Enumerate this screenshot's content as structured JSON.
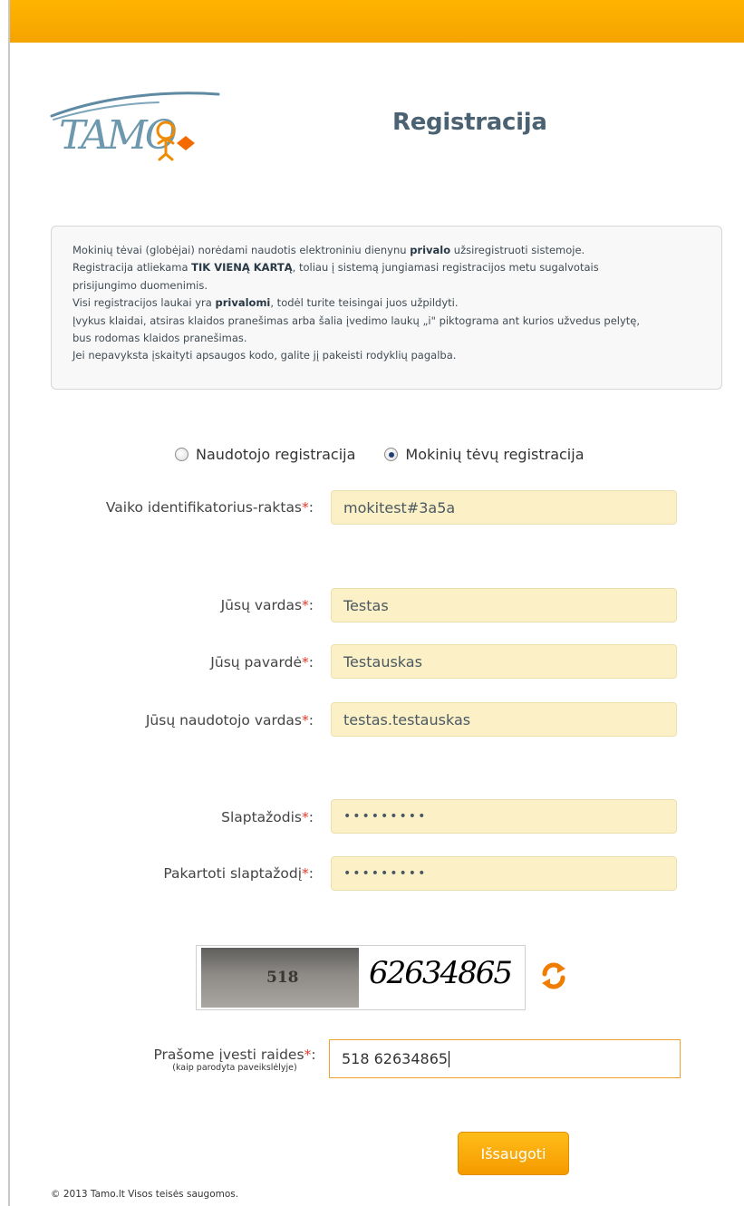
{
  "header": {
    "logo_text": "TAMO",
    "title": "Registracija"
  },
  "info": {
    "line1_a": "Mokinių tėvai (globėjai) norėdami naudotis elektroniniu dienynu ",
    "line1_b": "privalo",
    "line1_c": " užsiregistruoti sistemoje.",
    "line2_a": "Registracija atliekama ",
    "line2_b": "TIK VIENĄ KARTĄ",
    "line2_c": ", toliau į sistemą jungiamasi registracijos metu sugalvotais",
    "line3": "prisijungimo duomenimis.",
    "line4_a": "Visi registracijos laukai yra ",
    "line4_b": "privalomi",
    "line4_c": ", todėl turite teisingai juos užpildyti.",
    "line5": "Įvykus klaidai, atsiras klaidos pranešimas arba šalia įvedimo laukų „i\" piktograma ant kurios užvedus pelytę,",
    "line6": "bus rodomas klaidos pranešimas.",
    "line7": "Jei nepavyksta įskaityti apsaugos kodo, galite jį pakeisti rodyklių pagalba."
  },
  "registration_type": {
    "options": [
      {
        "label": "Naudotojo registracija",
        "selected": false
      },
      {
        "label": "Mokinių tėvų registracija",
        "selected": true
      }
    ]
  },
  "form": {
    "required_mark": "*",
    "colon": ":",
    "child_key": {
      "label": "Vaiko identifikatorius-raktas",
      "value": "mokitest#3a5a"
    },
    "first_name": {
      "label": "Jūsų vardas",
      "value": "Testas"
    },
    "last_name": {
      "label": "Jūsų pavardė",
      "value": "Testauskas"
    },
    "username": {
      "label": "Jūsų naudotojo vardas",
      "value": "testas.testauskas"
    },
    "password": {
      "label": "Slaptažodis",
      "value": "•••••••••"
    },
    "password_repeat": {
      "label": "Pakartoti slaptažodį",
      "value": "•••••••••"
    },
    "captcha": {
      "image_text_left": "518",
      "image_text_right": "62634865",
      "label": "Prašome įvesti raides",
      "hint": "(kaip parodyta paveikslėlyje)",
      "value": "518 62634865"
    },
    "save_label": "Išsaugoti"
  },
  "footer": {
    "text": "© 2013 Tamo.lt Visos teisės saugomos."
  },
  "colors": {
    "accent": "#f5a300",
    "title": "#4b6273",
    "field_bg": "#fcf0c6",
    "required": "#e53b2c",
    "refresh_icon": "#f07d00"
  },
  "icons": {
    "refresh": "refresh-icon",
    "logo": "tamo-logo"
  }
}
